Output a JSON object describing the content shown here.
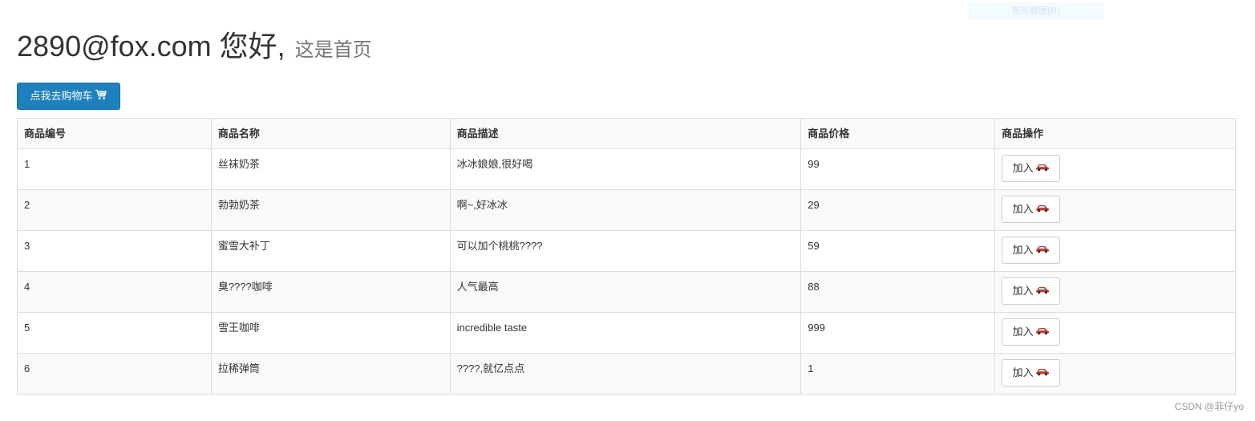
{
  "tooltip": "矩形截图(R)",
  "header": {
    "greeting": "2890@fox.com 您好,",
    "subtitle": "这是首页"
  },
  "cart_button": {
    "label": "点我去购物车",
    "icon": "shopping-cart-icon"
  },
  "table": {
    "columns": [
      "商品编号",
      "商品名称",
      "商品描述",
      "商品价格",
      "商品操作"
    ],
    "rows": [
      {
        "id": "1",
        "name": "丝袜奶茶",
        "desc": "冰冰娘娘,很好喝",
        "price": "99",
        "action": "加入"
      },
      {
        "id": "2",
        "name": "勃勃奶茶",
        "desc": "啊~,好冰冰",
        "price": "29",
        "action": "加入"
      },
      {
        "id": "3",
        "name": "蜜雪大补丁",
        "desc": "可以加个桃桃????",
        "price": "59",
        "action": "加入"
      },
      {
        "id": "4",
        "name": "臭????咖啡",
        "desc": "人气最高",
        "price": "88",
        "action": "加入"
      },
      {
        "id": "5",
        "name": "雪王咖啡",
        "desc": "incredible taste",
        "price": "999",
        "action": "加入"
      },
      {
        "id": "6",
        "name": "拉稀弹筒",
        "desc": "????,就亿点点",
        "price": "1",
        "action": "加入"
      }
    ],
    "action_icon": "car-icon"
  },
  "watermark": "CSDN @菲仔yo",
  "colors": {
    "primary_button": "#1e80bd",
    "border": "#dddddd",
    "stripe": "#f9f9f9"
  }
}
